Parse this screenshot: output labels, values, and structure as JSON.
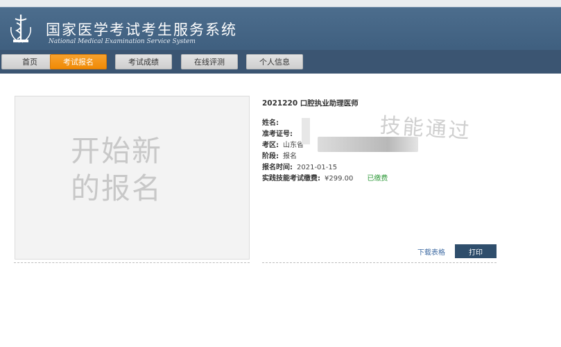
{
  "header": {
    "title_cn": "国家医学考试考生服务系统",
    "title_en": "National Medical Examination Service System"
  },
  "nav": [
    {
      "label": "首页",
      "active": false
    },
    {
      "label": "考试报名",
      "active": true
    },
    {
      "label": "考试成绩",
      "active": false
    },
    {
      "label": "在线评测",
      "active": false
    },
    {
      "label": "个人信息",
      "active": false
    }
  ],
  "new_registration": {
    "line1": "开始新",
    "line2": "的报名"
  },
  "registration": {
    "exam_title": "2021220 口腔执业助理医师",
    "name_label": "姓名:",
    "ticket_label": "准考证号:",
    "exam_area_label": "考区:",
    "exam_area_value": "山东省",
    "stage_label": "阶段:",
    "stage_value": "报名",
    "time_label": "报名时间:",
    "time_value": "2021-01-15",
    "fee_label": "实践技能考试缴费:",
    "fee_value": "¥299.00",
    "fee_status": "已缴费",
    "watermark": "技能通过"
  },
  "actions": {
    "download_label": "下载表格",
    "print_label": "打印"
  },
  "colors": {
    "header_bg": "#4c6d8d",
    "nav_bg": "#3b5572",
    "active_tab": "#f08a06",
    "paid_green": "#2f9a3a",
    "print_btn": "#2f4e6c"
  }
}
